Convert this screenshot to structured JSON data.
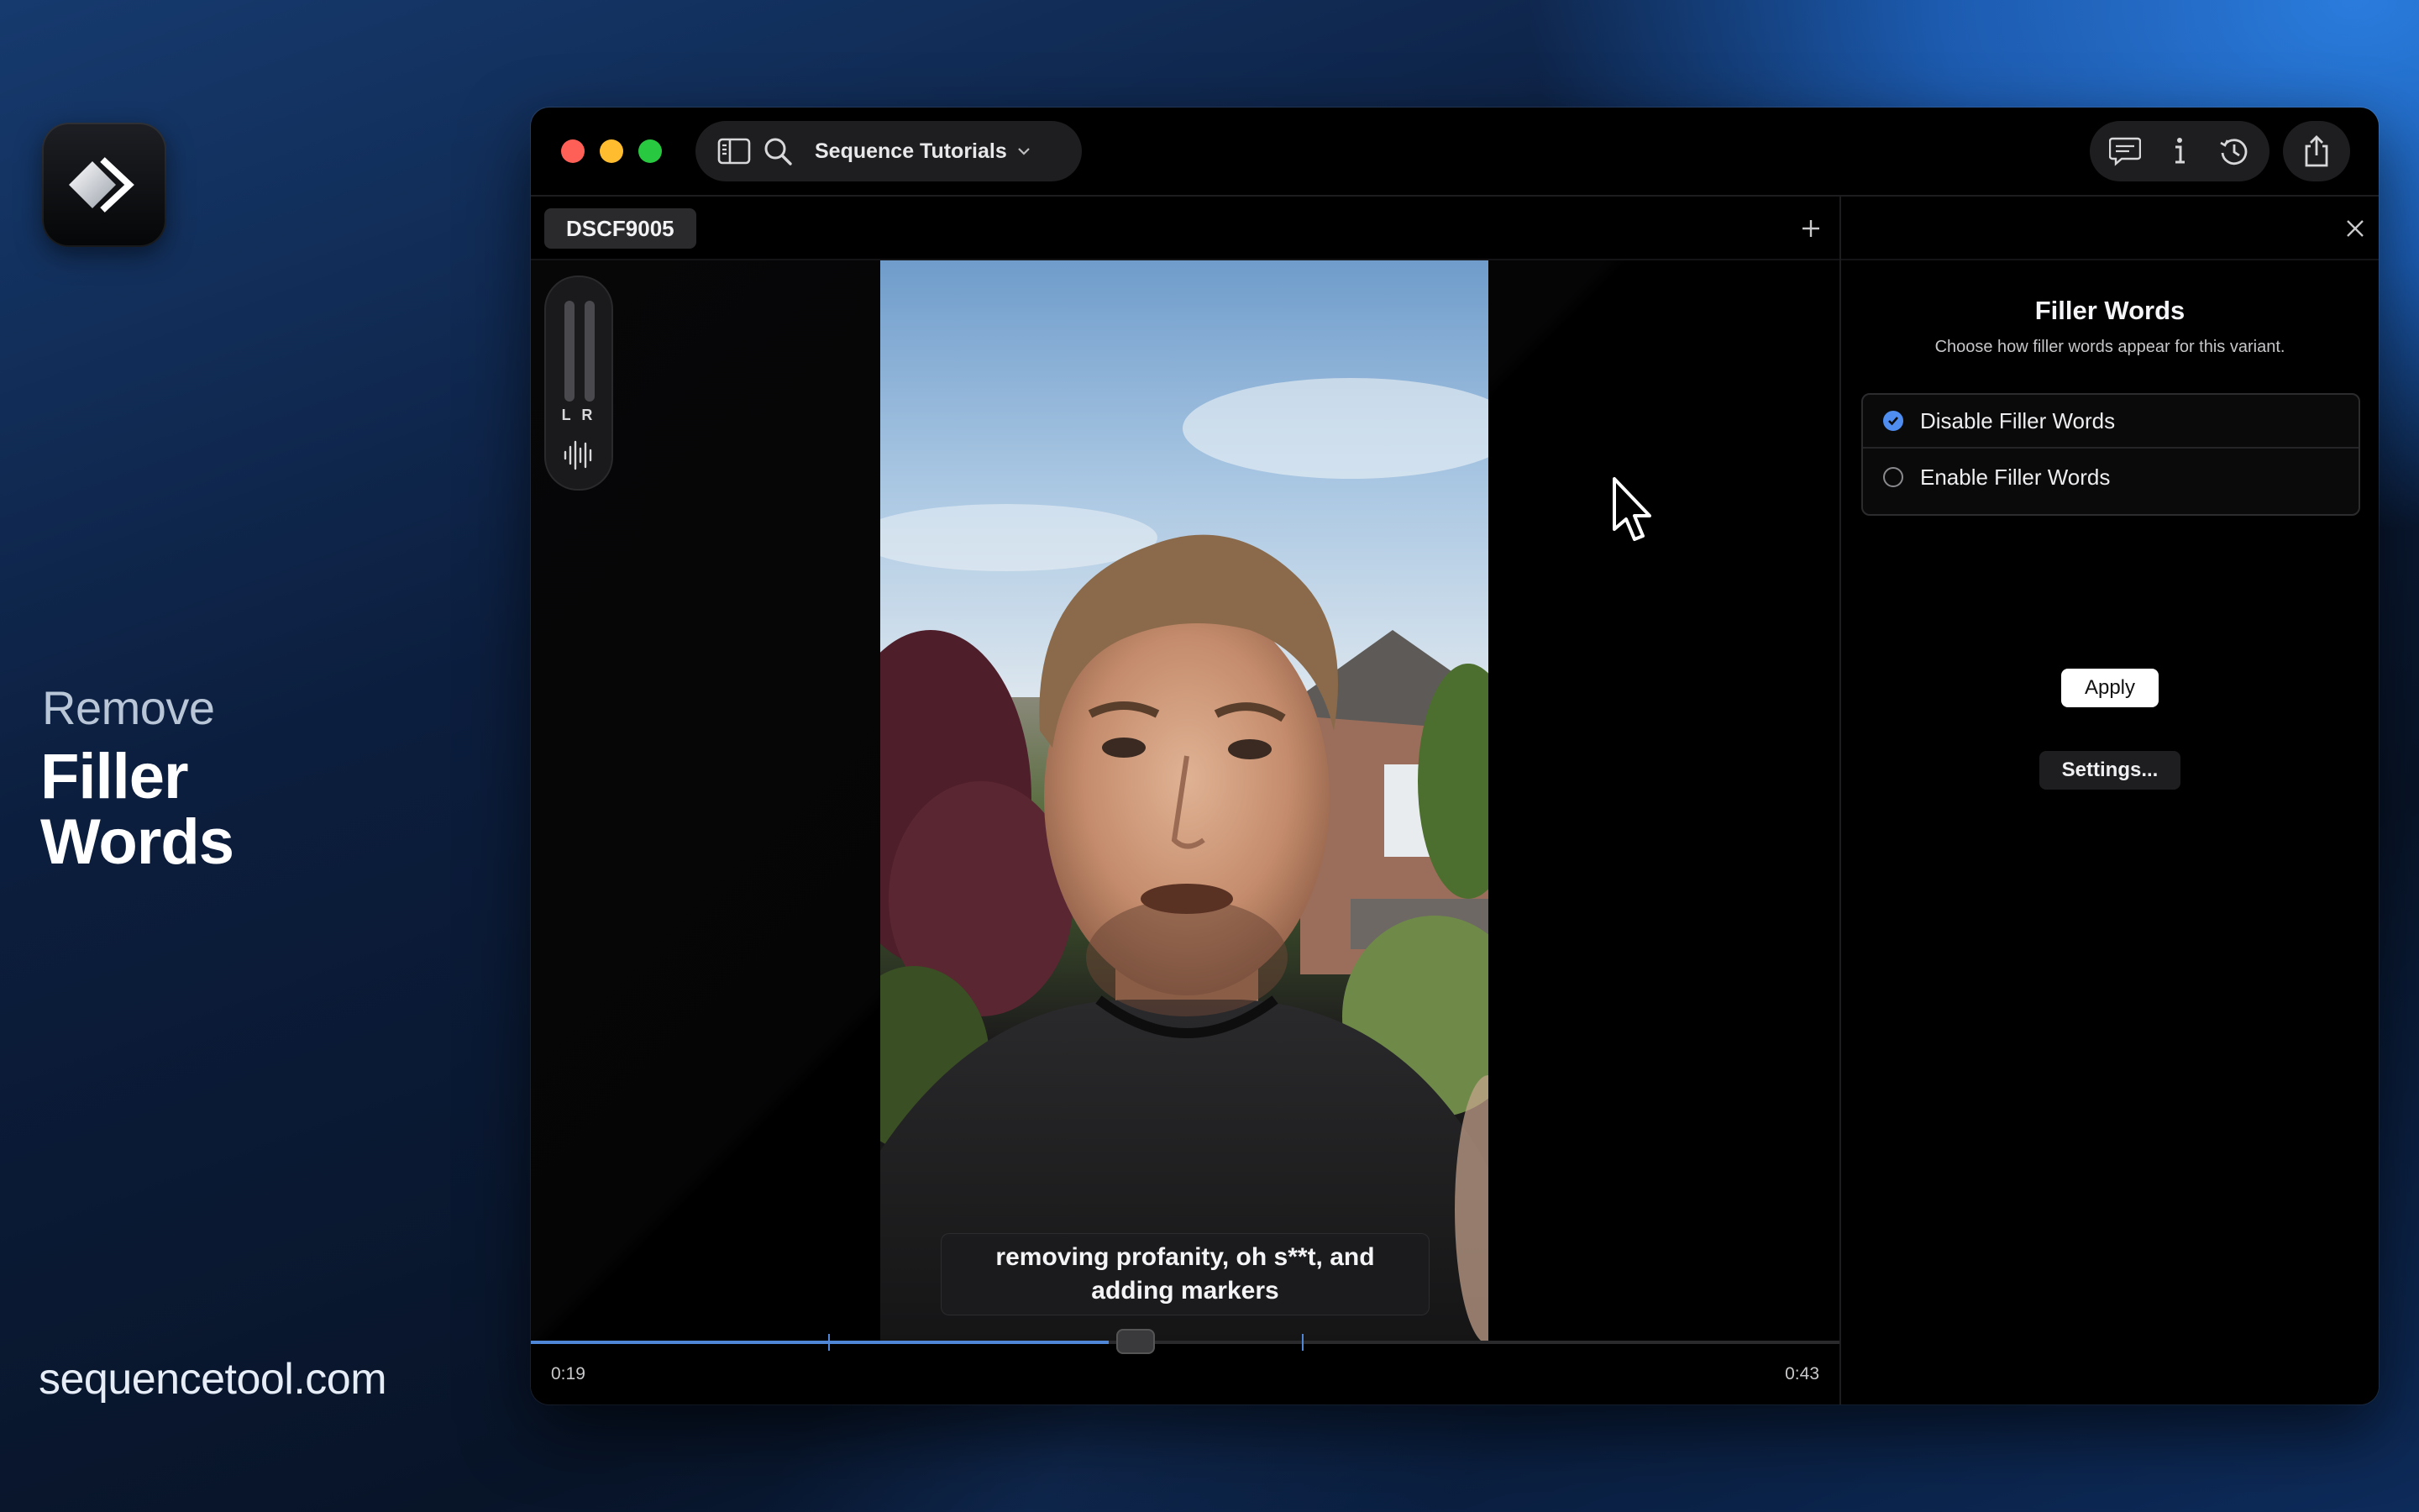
{
  "promo": {
    "remove": "Remove",
    "title_line1": "Filler",
    "title_line2": "Words",
    "url": "sequencetool.com"
  },
  "window": {
    "project_name": "Sequence Tutorials",
    "icons": [
      "sidebar-icon",
      "search-icon",
      "chevron-down-icon",
      "captions-icon",
      "info-icon",
      "history-icon",
      "share-icon"
    ]
  },
  "editor": {
    "tab_name": "DSCF9005",
    "meter_label": "L R",
    "caption": "removing profanity, oh s**t, and adding markers",
    "time_current": "0:19",
    "time_total": "0:43",
    "progress_fraction": 0.4418,
    "accent": "#4f86d6"
  },
  "panel": {
    "title": "Filler Words",
    "subtitle": "Choose how filler words appear for this variant.",
    "options": [
      {
        "label": "Disable Filler Words",
        "checked": true
      },
      {
        "label": "Enable Filler Words",
        "checked": false
      }
    ],
    "apply_label": "Apply",
    "settings_label": "Settings..."
  }
}
